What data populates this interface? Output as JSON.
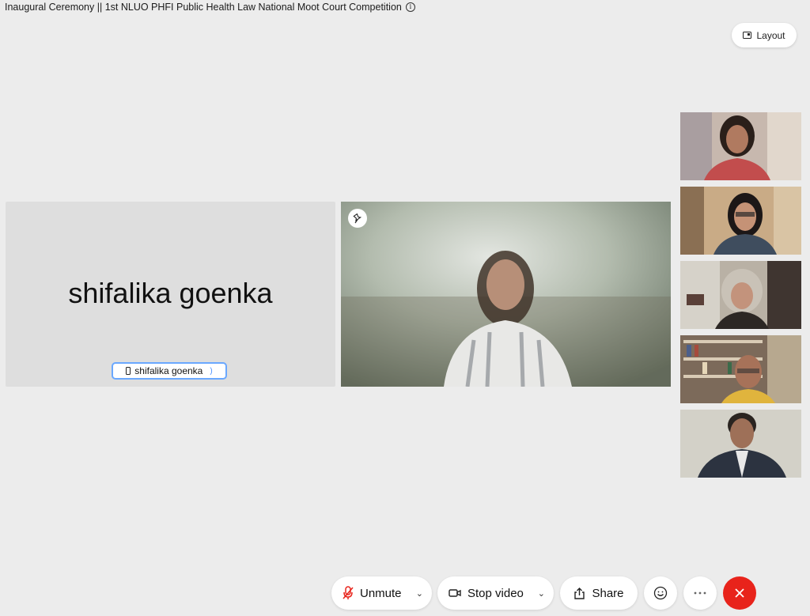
{
  "meeting": {
    "title": "Inaugural Ceremony || 1st NLUO PHFI Public Health Law National Moot Court Competition"
  },
  "toolbar_top": {
    "layout_label": "Layout"
  },
  "stage": {
    "audio_tile": {
      "display_name": "shifalika goenka",
      "label_name": "shifalika goenka"
    }
  },
  "controls": {
    "unmute_label": "Unmute",
    "stop_video_label": "Stop video",
    "share_label": "Share"
  },
  "colors": {
    "background": "#ececec",
    "end_call": "#e8231b",
    "muted_mic": "#e8231b",
    "label_border": "#6aa8ff"
  },
  "icons": {
    "info": "info-icon",
    "layout": "layout-icon",
    "pin": "pin-icon",
    "phone": "phone-icon",
    "mic_muted": "mic-muted-icon",
    "camera": "camera-icon",
    "share": "share-icon",
    "reactions": "smiley-icon",
    "more": "more-icon",
    "end_call": "close-icon"
  }
}
